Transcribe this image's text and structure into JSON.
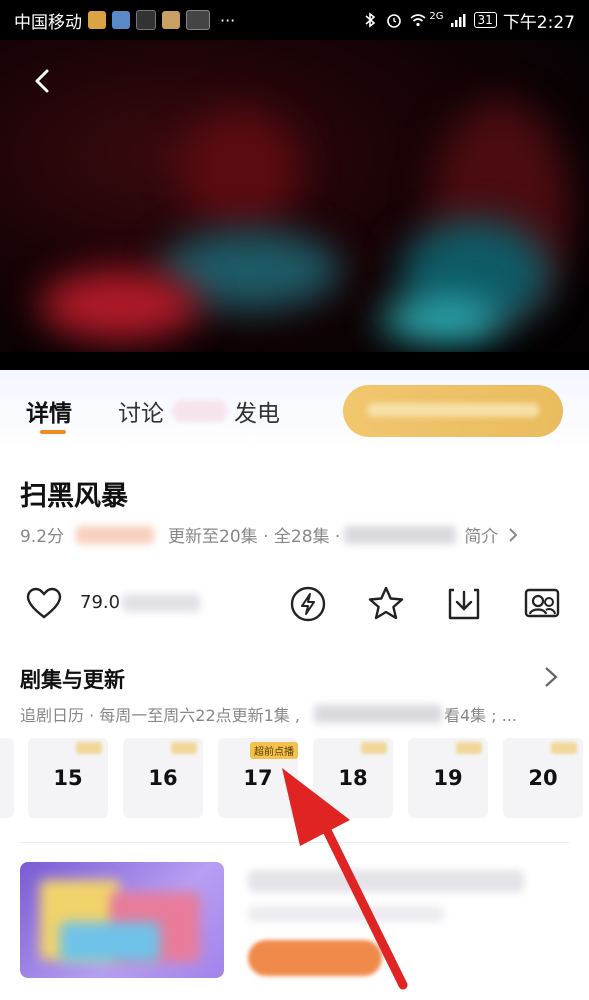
{
  "status_bar": {
    "carrier": "中国移动",
    "network": "2G",
    "battery": "31",
    "time": "下午2:27",
    "more": "···"
  },
  "tabs": {
    "details": "详情",
    "discussion": "讨论",
    "power": "发电"
  },
  "show": {
    "title": "扫黑风暴",
    "score": "9.2分",
    "update": "更新至20集 · 全28集 ·",
    "intro": "简介",
    "likes": "79.0"
  },
  "episodes": {
    "title": "剧集与更新",
    "schedule_prefix": "追剧日历 · 每周一至周六22点更新1集 ,",
    "schedule_suffix": "看4集 ; ...",
    "items": [
      {
        "num": "15"
      },
      {
        "num": "16"
      },
      {
        "num": "17",
        "tag": "超前点播"
      },
      {
        "num": "18"
      },
      {
        "num": "19"
      },
      {
        "num": "20"
      }
    ]
  },
  "colors": {
    "accent": "#f08a24",
    "vip_gold": "#e9bc5e",
    "annotation_arrow": "#e02424"
  }
}
